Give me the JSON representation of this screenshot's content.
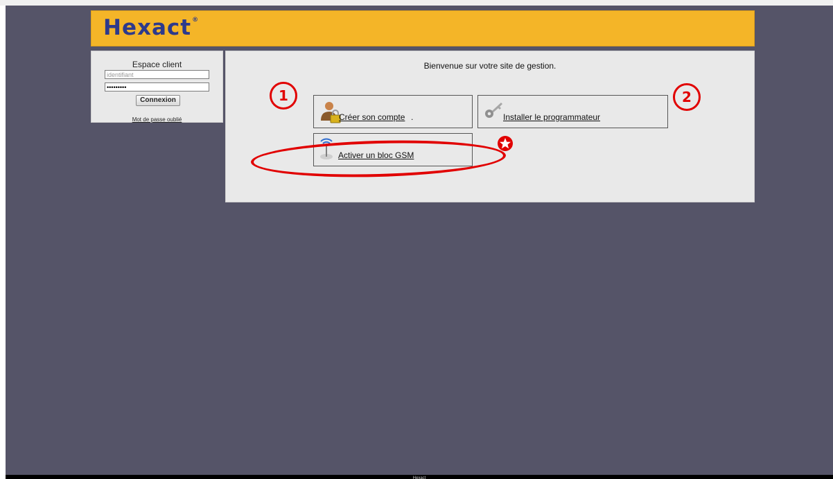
{
  "header": {
    "logo_text": "Hexact",
    "logo_mark": "®"
  },
  "login": {
    "title": "Espace client",
    "identifier_placeholder": "identifiant",
    "password_value": "•••••••••",
    "connect_label": "Connexion",
    "forgot_label": "Mot de passe oublié"
  },
  "main": {
    "welcome": "Bienvenue sur votre site de gestion.",
    "actions": [
      {
        "label": "Créer son compte",
        "suffix": ".",
        "icon": "user-lock-icon"
      },
      {
        "label": "Installer le programmateur",
        "icon": "key-icon"
      },
      {
        "label": "Activer un bloc GSM",
        "icon": "gsm-antenna-icon"
      }
    ]
  },
  "annotations": {
    "step1": "1",
    "step2": "2",
    "highlight_color": "#e10000",
    "star_icon": "star-badge-icon"
  },
  "footer": {
    "text": "Hexact"
  },
  "colors": {
    "header_bg": "#f4b528",
    "page_bg": "#555468",
    "logo_color": "#2d3a8c"
  }
}
